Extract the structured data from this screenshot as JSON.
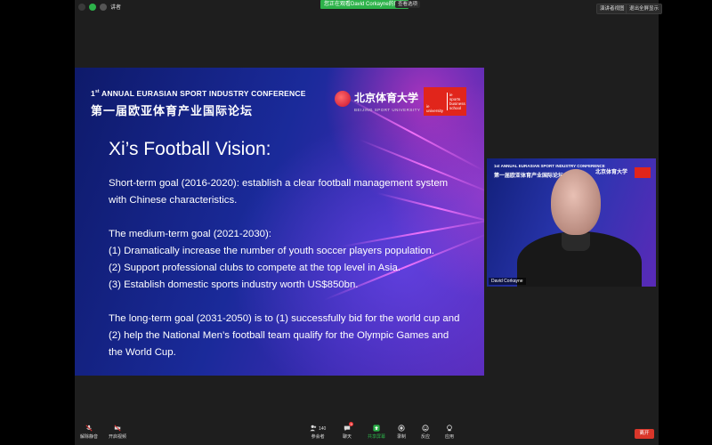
{
  "top": {
    "user_label": "讲者",
    "share_banner": "您正在观看David Corkayne的屏幕",
    "view_options": "查看选项",
    "speaker_view": "演讲者视图",
    "exit_fullscreen": "退出全屏显示"
  },
  "slide": {
    "conference_en_prefix": "1",
    "conference_en_sup": "st",
    "conference_en_rest": " ANNUAL EURASIAN SPORT INDUSTRY CONFERENCE",
    "conference_cn": "第一届欧亚体育产业国际论坛",
    "university_cn": "北京体育大学",
    "university_en": "BEIJING SPORT UNIVERSITY",
    "ie_left": "ie\nuniversity",
    "ie_right": "ie\nsports\nbusiness\nschool",
    "heading": "Xi’s Football Vision:",
    "short_term": "Short-term goal (2016-2020): establish a clear football management system with Chinese characteristics.",
    "medium_intro": "The medium-term goal (2021-2030):",
    "medium_1": "(1)  Dramatically increase the number of youth soccer players population.",
    "medium_2": "(2)  Support professional clubs to compete at the top level in Asia.",
    "medium_3": "(3)  Establish domestic sports industry worth US$850bn.",
    "long_term": "The long-term goal (2031-2050) is to (1) successfully bid for the world cup and (2) help the National Men’s football team qualify for the Olympic Games and the World Cup."
  },
  "video": {
    "conference_en": "1st ANNUAL EURASIAN SPORT INDUSTRY CONFERENCE",
    "conference_cn": "第一届欧亚体育产业国际论坛",
    "logo_cn": "北京体育大学",
    "participant_name": "David Corkayne"
  },
  "toolbar": {
    "mute": "解除静音",
    "start_video": "开启视频",
    "participants": "参会者",
    "participants_count": "140",
    "chat": "聊天",
    "chat_badge": "9",
    "share_screen": "共享屏幕",
    "record": "录制",
    "reactions": "反应",
    "apps": "应用",
    "leave": "离开"
  }
}
